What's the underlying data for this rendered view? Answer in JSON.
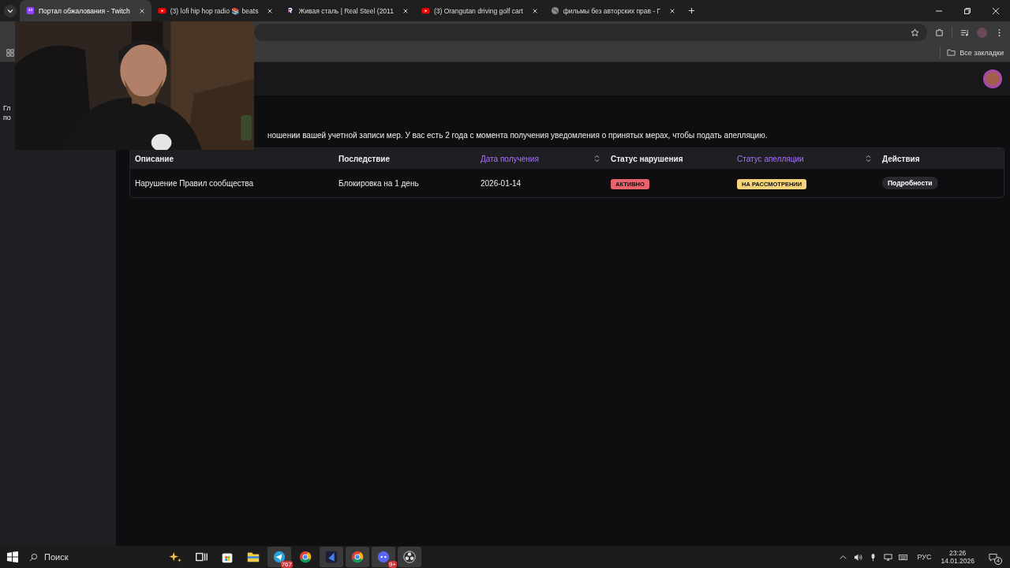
{
  "browser": {
    "tabs": [
      {
        "title": "Портал обжалования - Twitch",
        "kind": "twitch",
        "selected": true
      },
      {
        "title": "(3) lofi hip hop radio 📚 beats",
        "kind": "youtube",
        "selected": false
      },
      {
        "title": "Живая сталь | Real Steel (2011",
        "kind": "r",
        "selected": false
      },
      {
        "title": "(3) Orangutan driving golf cart",
        "kind": "youtube",
        "selected": false
      },
      {
        "title": "фильмы без авторских прав - Г",
        "kind": "globe",
        "selected": false
      }
    ],
    "bookmarks_label": "Все закладки"
  },
  "sidebar": {
    "fragments": [
      "Гл",
      "по"
    ]
  },
  "page": {
    "notice": "ношении вашей учетной записи мер. У вас есть 2 года с момента получения уведомления о принятых мерах, чтобы подать апелляцию.",
    "table": {
      "columns": [
        {
          "label": "Описание",
          "sortable": false
        },
        {
          "label": "Последствие",
          "sortable": false
        },
        {
          "label": "Дата получения",
          "sortable": true
        },
        {
          "label": "Статус нарушения",
          "sortable": false
        },
        {
          "label": "Статус апелляции",
          "sortable": true
        },
        {
          "label": "Действия",
          "sortable": false
        }
      ],
      "rows": [
        {
          "description": "Нарушение Правил сообщества",
          "consequence": "Блокировка на 1 день",
          "date": "2026-01-14",
          "violation_status": {
            "label": "АКТИВНО",
            "color": "#e8636b"
          },
          "appeal_status": {
            "label": "НА РАССМОТРЕНИИ",
            "color": "#f5d37a"
          },
          "action": "Подробности"
        }
      ]
    }
  },
  "taskbar": {
    "search": "Поиск",
    "apps": [
      {
        "kind": "copilot",
        "running": false
      },
      {
        "kind": "taskview",
        "running": false
      },
      {
        "kind": "store",
        "running": false
      },
      {
        "kind": "folder",
        "running": false
      },
      {
        "kind": "telegram",
        "running": true,
        "badge": "767"
      },
      {
        "kind": "chrome",
        "running": false
      },
      {
        "kind": "editor",
        "running": true
      },
      {
        "kind": "chrome",
        "running": true
      },
      {
        "kind": "discord",
        "running": true,
        "badge": "9+"
      },
      {
        "kind": "obs",
        "running": true
      }
    ],
    "language": "РУС",
    "time": "23:26",
    "date": "14.01.2026",
    "notifications": "4"
  }
}
